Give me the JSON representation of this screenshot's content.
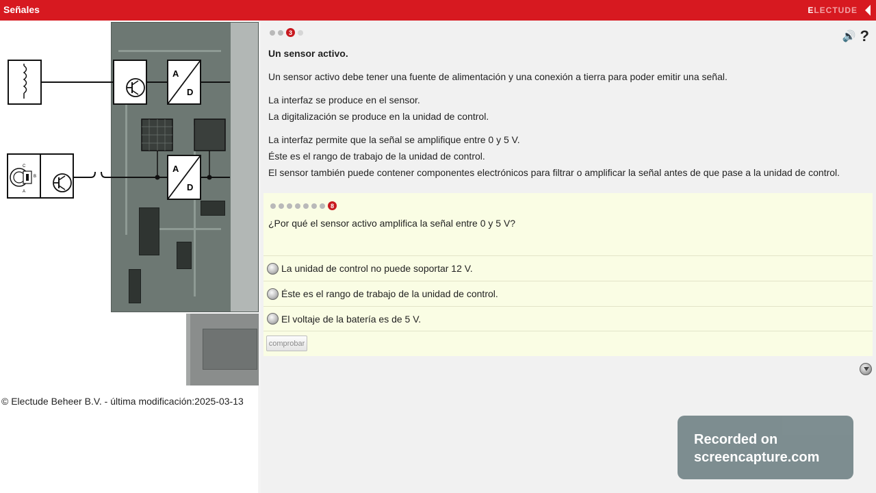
{
  "header": {
    "title": "Señales",
    "brand_first": "E",
    "brand_rest": "LECTUDE",
    "accent_color": "#d71920"
  },
  "diagram": {
    "top_adc_a": "A",
    "top_adc_d": "D",
    "bottom_adc_a": "A",
    "bottom_adc_d": "D",
    "sensor_pins": [
      "C",
      "B",
      "A"
    ]
  },
  "footer": {
    "copyright": "© Electude Beheer B.V. - última modificación:2025-03-13"
  },
  "lesson": {
    "page_indicator": {
      "total_dots": 4,
      "active_label": "3"
    },
    "heading": "Un sensor activo.",
    "paragraphs": [
      "Un sensor activo debe tener una fuente de alimentación y una conexión a tierra para poder emitir una señal.",
      "La interfaz se produce en el sensor.",
      "La digitalización se produce en la unidad de control.",
      "La interfaz permite que la señal se amplifique entre 0 y 5 V.",
      "Éste es el rango de trabajo de la unidad de control.",
      "El sensor también puede contener componentes electrónicos para filtrar o amplificar la señal antes de que pase a la unidad de control."
    ],
    "icons": [
      "speaker-icon",
      "help-icon"
    ]
  },
  "quiz": {
    "question_indicator": {
      "total_dots": 8,
      "active_label": "8"
    },
    "question": "¿Por qué el sensor activo amplifica la señal entre 0 y 5 V?",
    "options": [
      "La unidad de control no puede soportar 12 V.",
      "Éste es el rango de trabajo de la unidad de control.",
      "El voltaje de la batería es de 5 V."
    ],
    "check_label": "comprobar"
  },
  "watermark": {
    "line1": "Recorded on",
    "line2": "screencapture.com"
  }
}
